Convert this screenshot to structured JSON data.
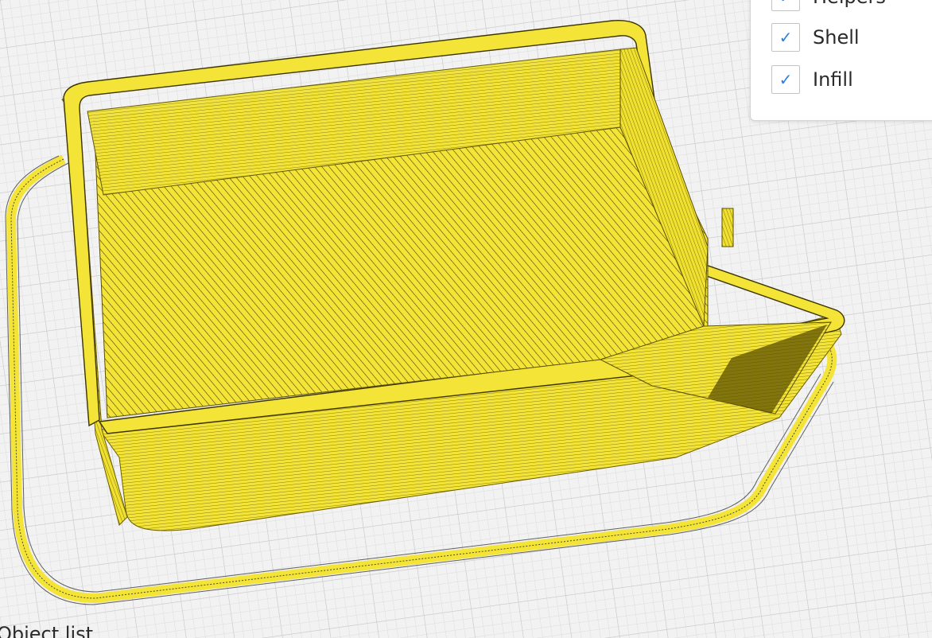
{
  "view_panel": {
    "items": [
      {
        "label": "Helpers",
        "checked": true,
        "check_glyph": "✓"
      },
      {
        "label": "Shell",
        "checked": true,
        "check_glyph": "✓"
      },
      {
        "label": "Infill",
        "checked": true,
        "check_glyph": "✓"
      }
    ]
  },
  "object_list": {
    "title": "Object list"
  },
  "colors": {
    "filament": "#f3e437",
    "check": "#2f7fe0",
    "grid_bg": "#f2f2f2"
  },
  "icons": {
    "checkmark": "check-icon"
  }
}
